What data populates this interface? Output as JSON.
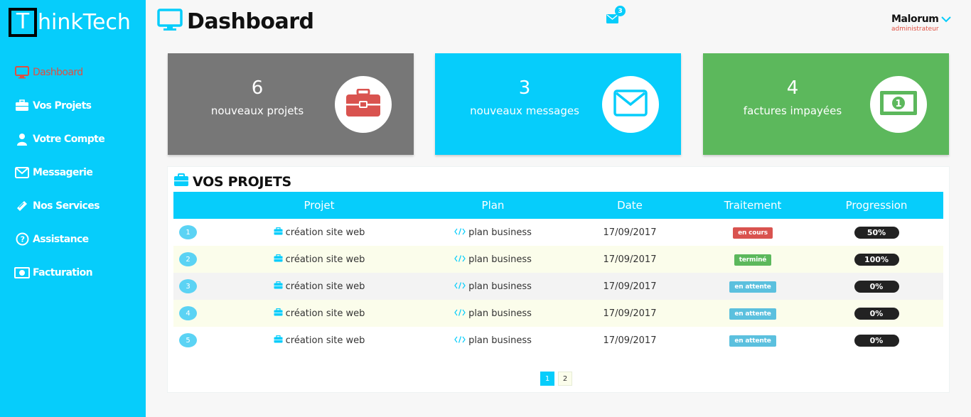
{
  "app": {
    "logo_letter": "T",
    "logo_rest": "hinkTech"
  },
  "sidebar": {
    "items": [
      {
        "label": "Dashboard",
        "icon": "monitor-icon",
        "active": true
      },
      {
        "label": "Vos Projets",
        "icon": "briefcase-icon"
      },
      {
        "label": "Votre Compte",
        "icon": "user-icon"
      },
      {
        "label": "Messagerie",
        "icon": "envelope-icon"
      },
      {
        "label": "Nos Services",
        "icon": "ticket-icon"
      },
      {
        "label": "Assistance",
        "icon": "question-circle-icon"
      },
      {
        "label": "Facturation",
        "icon": "money-bill-icon"
      }
    ]
  },
  "header": {
    "title": "Dashboard",
    "messages_count": "3",
    "user_name": "Malorum",
    "user_role": "administrateur"
  },
  "cards": [
    {
      "value": "6",
      "label": "nouveaux projets",
      "color": "#777777",
      "icon": "briefcase-icon"
    },
    {
      "value": "3",
      "label": "nouveaux messages",
      "color": "#06cdfb",
      "icon": "envelope-icon"
    },
    {
      "value": "4",
      "label": "factures impayées",
      "color": "#5cb85c",
      "icon": "money-bill-icon"
    }
  ],
  "projects": {
    "title": "VOS PROJETS",
    "columns": [
      "",
      "Projet",
      "Plan",
      "Date",
      "Traitement",
      "Progression"
    ],
    "rows": [
      {
        "n": "1",
        "projet": "création site web",
        "plan": "plan business",
        "date": "17/09/2017",
        "status": "en cours",
        "status_color": "#d9534f",
        "progress": "50%"
      },
      {
        "n": "2",
        "projet": "création site web",
        "plan": "plan business",
        "date": "17/09/2017",
        "status": "terminé",
        "status_color": "#5cb85c",
        "progress": "100%"
      },
      {
        "n": "3",
        "projet": "création site web",
        "plan": "plan business",
        "date": "17/09/2017",
        "status": "en attente",
        "status_color": "#5bc0de",
        "progress": "0%"
      },
      {
        "n": "4",
        "projet": "création site web",
        "plan": "plan business",
        "date": "17/09/2017",
        "status": "en attente",
        "status_color": "#5bc0de",
        "progress": "0%"
      },
      {
        "n": "5",
        "projet": "création site web",
        "plan": "plan business",
        "date": "17/09/2017",
        "status": "en attente",
        "status_color": "#5bc0de",
        "progress": "0%"
      }
    ],
    "pages": [
      "1",
      "2"
    ],
    "current_page": "1"
  }
}
